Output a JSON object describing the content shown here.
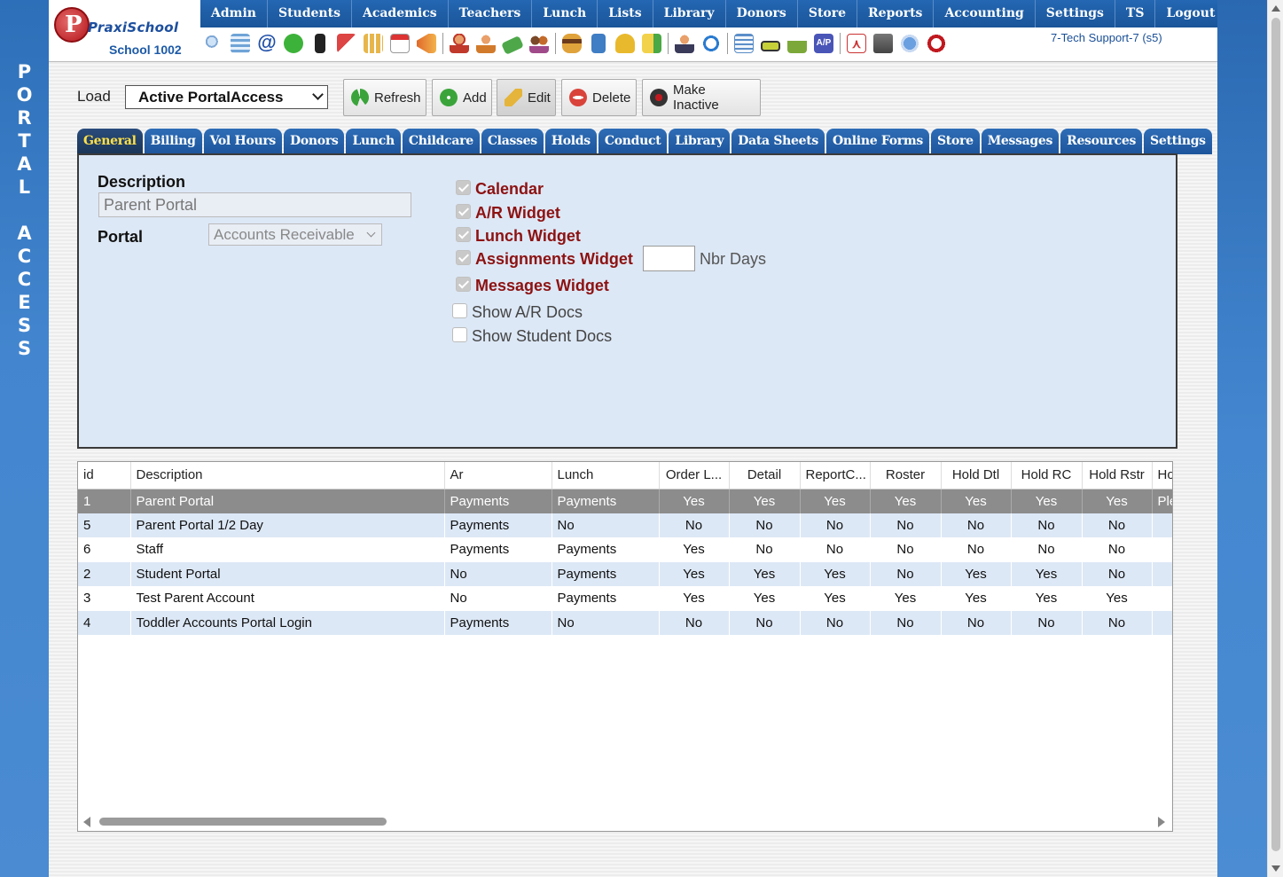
{
  "side_title": [
    "P",
    "O",
    "R",
    "T",
    "A",
    "L",
    "",
    "A",
    "C",
    "C",
    "E",
    "S",
    "S"
  ],
  "brand": {
    "name": "PraxiSchool",
    "school": "School 1002"
  },
  "nav": [
    "Admin",
    "Students",
    "Academics",
    "Teachers",
    "Lunch",
    "Lists",
    "Library",
    "Donors",
    "Store",
    "Reports",
    "Accounting",
    "Settings",
    "TS",
    "Logout"
  ],
  "toolbar_icons": [
    "search-icon",
    "spreadsheet-icon",
    "email-icon",
    "chat-icon",
    "phone-icon",
    "flag-icon",
    "calendar-grid-icon",
    "calendar-icon",
    "megaphone-icon",
    "add-user-icon",
    "user-icon",
    "money-icon",
    "group-icon",
    "lunch-icon",
    "book-icon",
    "bell-icon",
    "export-icon",
    "teacher-icon",
    "clock-icon",
    "list-icon",
    "ticket-icon",
    "print-icon",
    "ap-icon",
    "pdf-icon",
    "cash-register-icon",
    "help-icon",
    "stop-icon"
  ],
  "user_label": "7-Tech Support-7 (s5)",
  "load": {
    "label": "Load",
    "selected": "Active PortalAccess"
  },
  "buttons": {
    "refresh": "Refresh",
    "add": "Add",
    "edit": "Edit",
    "delete": "Delete",
    "make_inactive": "Make Inactive"
  },
  "tabs": [
    "General",
    "Billing",
    "Vol Hours",
    "Donors",
    "Lunch",
    "Childcare",
    "Classes",
    "Holds",
    "Conduct",
    "Library",
    "Data Sheets",
    "Online Forms",
    "Store",
    "Messages",
    "Resources",
    "Settings"
  ],
  "form": {
    "description_label": "Description",
    "description_value": "Parent Portal",
    "portal_label": "Portal",
    "portal_value": "Accounts Receivable",
    "checkboxes": {
      "calendar": "Calendar",
      "ar_widget": "A/R Widget",
      "lunch_widget": "Lunch Widget",
      "assignments_widget": "Assignments Widget",
      "messages_widget": "Messages Widget",
      "show_ar_docs": "Show A/R Docs",
      "show_student_docs": "Show Student Docs"
    },
    "nbr_days_label": "Nbr Days"
  },
  "grid": {
    "columns": [
      "id",
      "Description",
      "Ar",
      "Lunch",
      "Order L...",
      "Detail",
      "ReportC...",
      "Roster",
      "Hold Dtl",
      "Hold RC",
      "Hold Rstr",
      "Ho"
    ],
    "rows": [
      [
        "1",
        "Parent Portal",
        "Payments",
        "Payments",
        "Yes",
        "Yes",
        "Yes",
        "Yes",
        "Yes",
        "Yes",
        "Yes",
        "Ple"
      ],
      [
        "5",
        "Parent Portal 1/2 Day",
        "Payments",
        "No",
        "No",
        "No",
        "No",
        "No",
        "No",
        "No",
        "No",
        ""
      ],
      [
        "6",
        "Staff",
        "Payments",
        "Payments",
        "Yes",
        "No",
        "No",
        "No",
        "No",
        "No",
        "No",
        ""
      ],
      [
        "2",
        "Student Portal",
        "No",
        "Payments",
        "Yes",
        "Yes",
        "Yes",
        "No",
        "Yes",
        "Yes",
        "No",
        ""
      ],
      [
        "3",
        "Test Parent Account",
        "No",
        "Payments",
        "Yes",
        "Yes",
        "Yes",
        "Yes",
        "Yes",
        "Yes",
        "Yes",
        ""
      ],
      [
        "4",
        "Toddler Accounts Portal Login",
        "Payments",
        "No",
        "No",
        "No",
        "No",
        "No",
        "No",
        "No",
        "No",
        ""
      ]
    ]
  }
}
